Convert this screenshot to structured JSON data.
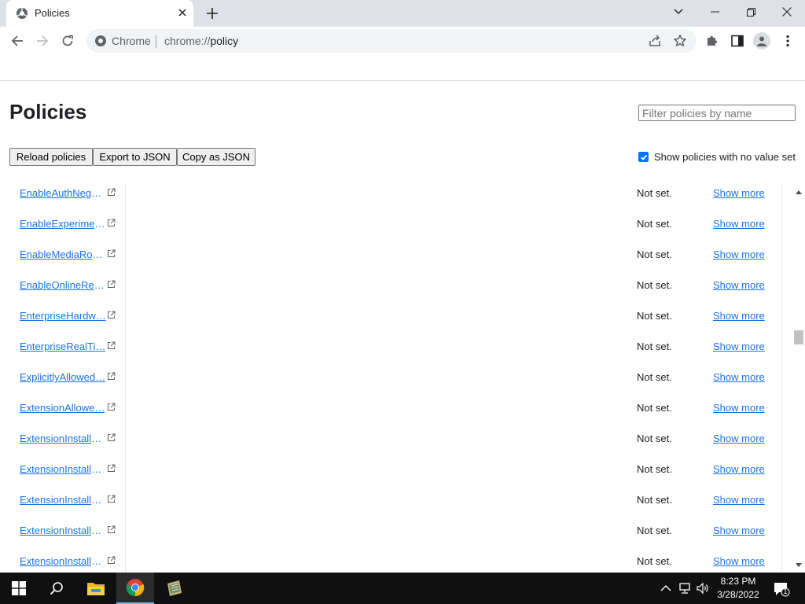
{
  "tab": {
    "title": "Policies"
  },
  "toolbar": {
    "site_label": "Chrome",
    "url_prefix": "chrome://",
    "url_path": "policy"
  },
  "page": {
    "title": "Policies",
    "filter_placeholder": "Filter policies by name",
    "buttons": {
      "reload": "Reload policies",
      "export": "Export to JSON",
      "copy": "Copy as JSON"
    },
    "show_no_value_label": "Show policies with no value set"
  },
  "policies": [
    {
      "name": "EnableAuthNegot…",
      "value": "Not set.",
      "action": "Show more"
    },
    {
      "name": "EnableExperimen…",
      "value": "Not set.",
      "action": "Show more"
    },
    {
      "name": "EnableMediaRou…",
      "value": "Not set.",
      "action": "Show more"
    },
    {
      "name": "EnableOnlineRev…",
      "value": "Not set.",
      "action": "Show more"
    },
    {
      "name": "EnterpriseHardw…",
      "value": "Not set.",
      "action": "Show more"
    },
    {
      "name": "EnterpriseRealTi…",
      "value": "Not set.",
      "action": "Show more"
    },
    {
      "name": "ExplicitlyAllowed…",
      "value": "Not set.",
      "action": "Show more"
    },
    {
      "name": "ExtensionAllowe…",
      "value": "Not set.",
      "action": "Show more"
    },
    {
      "name": "ExtensionInstallA…",
      "value": "Not set.",
      "action": "Show more"
    },
    {
      "name": "ExtensionInstallB…",
      "value": "Not set.",
      "action": "Show more"
    },
    {
      "name": "ExtensionInstallB…",
      "value": "Not set.",
      "action": "Show more"
    },
    {
      "name": "ExtensionInstallF…",
      "value": "Not set.",
      "action": "Show more"
    },
    {
      "name": "ExtensionInstallS…",
      "value": "Not set.",
      "action": "Show more"
    }
  ],
  "taskbar": {
    "time": "8:23 PM",
    "date": "3/28/2022",
    "notification_count": "1"
  },
  "colors": {
    "link": "#1a73e8",
    "checkbox": "#0075ff",
    "tabstrip": "#dee1e6",
    "taskbar": "#101010"
  }
}
